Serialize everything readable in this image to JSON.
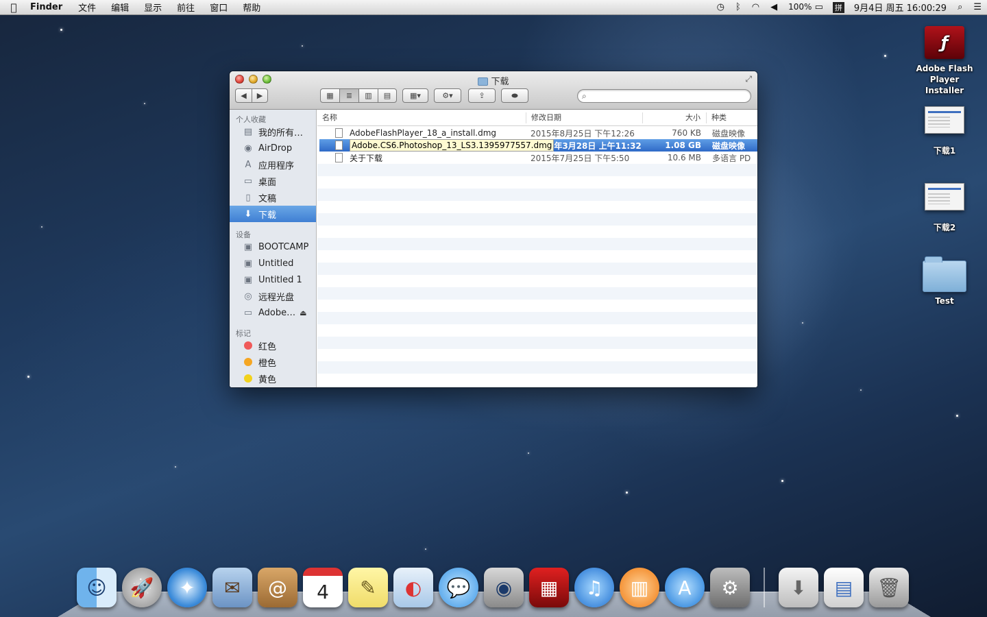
{
  "menubar": {
    "apple": "",
    "app_name": "Finder",
    "menus": [
      "文件",
      "编辑",
      "显示",
      "前往",
      "窗口",
      "帮助"
    ],
    "battery": "100%",
    "input_method": "拼",
    "datetime": "9月4日 周五  16:00:29"
  },
  "window": {
    "title": "下载",
    "sidebar": {
      "favorites_header": "个人收藏",
      "favorites": [
        "我的所有…",
        "AirDrop",
        "应用程序",
        "桌面",
        "文稿",
        "下载"
      ],
      "devices_header": "设备",
      "devices": [
        "BOOTCAMP",
        "Untitled",
        "Untitled 1",
        "远程光盘",
        "Adobe…"
      ],
      "tags_header": "标记",
      "tags": [
        {
          "label": "红色",
          "color": "#f05a5a"
        },
        {
          "label": "橙色",
          "color": "#f5a623"
        },
        {
          "label": "黄色",
          "color": "#f2d21c"
        }
      ]
    },
    "columns": {
      "name": "名称",
      "date": "修改日期",
      "size": "大小",
      "kind": "种类"
    },
    "files": [
      {
        "name": "AdobeFlashPlayer_18_a_install.dmg",
        "date": "2015年8月25日 下午12:26",
        "size": "760 KB",
        "kind": "磁盘映像"
      },
      {
        "name": "Adobe.CS6.Photoshop_13_LS3.1395977557.dmg",
        "date": "4年3月28日 上午11:32",
        "size": "1.08 GB",
        "kind": "磁盘映像"
      },
      {
        "name": "关于下载",
        "date": "2015年7月25日 下午5:50",
        "size": "10.6 MB",
        "kind": "多语言 PD"
      }
    ]
  },
  "desktop": {
    "icons": [
      "Adobe Flash Player Installer",
      "下载1",
      "下载2",
      "Test"
    ]
  }
}
